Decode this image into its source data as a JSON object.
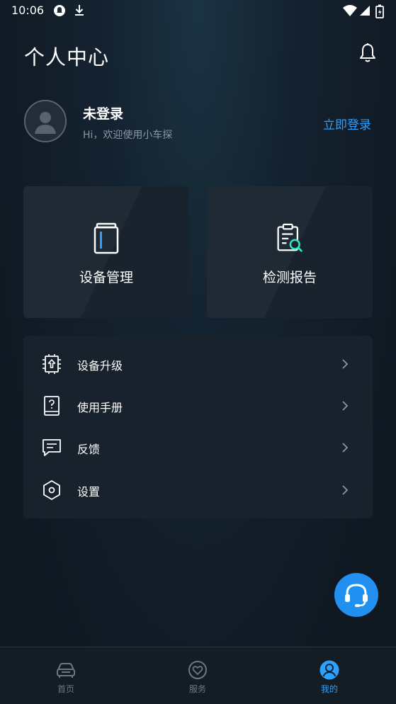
{
  "status_bar": {
    "time": "10:06"
  },
  "header": {
    "title": "个人中心"
  },
  "profile": {
    "name": "未登录",
    "subtitle": "Hi，欢迎使用小车探",
    "login_label": "立即登录"
  },
  "cards": [
    {
      "label": "设备管理",
      "icon": "device-battery-icon"
    },
    {
      "label": "检测报告",
      "icon": "report-clipboard-icon"
    }
  ],
  "menu": [
    {
      "label": "设备升级",
      "icon": "chip-upgrade-icon"
    },
    {
      "label": "使用手册",
      "icon": "manual-book-icon"
    },
    {
      "label": "反馈",
      "icon": "feedback-chat-icon"
    },
    {
      "label": "设置",
      "icon": "settings-hexagon-icon"
    }
  ],
  "bottom_nav": [
    {
      "label": "首页",
      "icon": "car-icon",
      "active": false
    },
    {
      "label": "服务",
      "icon": "heart-circle-icon",
      "active": false
    },
    {
      "label": "我的",
      "icon": "user-circle-icon",
      "active": true
    }
  ],
  "colors": {
    "accent": "#2ea0ff",
    "fab": "#2290f0",
    "background": "#111a24"
  }
}
